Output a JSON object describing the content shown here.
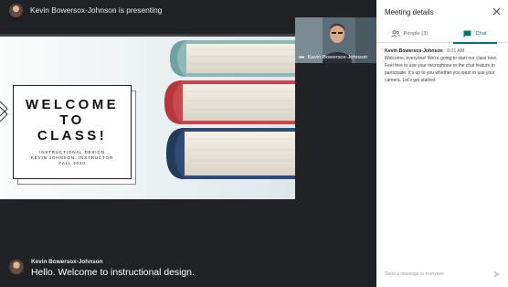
{
  "meeting": {
    "presenter_banner": "Kevin Bowersox-Johnson is presenting"
  },
  "slide": {
    "title": "WELCOME\nTO\nCLASS!",
    "subtitle_line1": "INSTRUCTIONAL DESIGN",
    "subtitle_line2": "KEVIN JOHNSON, INSTRUCTOR",
    "subtitle_line3": "FALL 2020"
  },
  "self_view": {
    "name": "Kevin Bowersox-Johnson",
    "menu_icon": "more-dots-icon"
  },
  "caption": {
    "speaker": "Kevin Bowersox-Johnson",
    "text": "Hello. Welcome to instructional design."
  },
  "panel": {
    "title": "Meeting details",
    "tabs": [
      {
        "label": "People (3)",
        "icon": "people-icon"
      },
      {
        "label": "Chat",
        "icon": "chat-icon"
      }
    ],
    "active_tab": "Chat",
    "accent_color": "#00796b",
    "messages": [
      {
        "sender": "Kevin Bowersox-Johnson",
        "time": "9:01 AM",
        "text": "Welcome, everyone! We're going to start our class now. Feel free to use your microphone or the chat feature to participate. It's up to you whether you want to use your camera. Let's get started."
      }
    ],
    "composer_placeholder": "Send a message to everyone"
  }
}
